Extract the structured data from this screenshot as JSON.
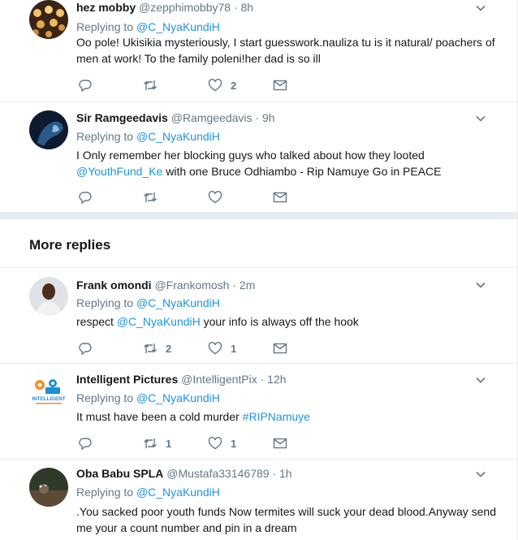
{
  "tweets_top": [
    {
      "name": "hez mobby",
      "handle": "@zepphimobby78",
      "time": "· 8h",
      "replying_label": "Replying to",
      "replying_handle": "@C_NyaKundiH",
      "text": "Oo pole! Ukisikia mysteriously, I start guesswork.nauliza tu is it natural/ poachers of men at work! To the family poleni!her dad is so ill",
      "retweets": "",
      "likes": "2"
    },
    {
      "name": "Sir Ramgeedavis",
      "handle": "@Ramgeedavis",
      "time": "· 9h",
      "replying_label": "Replying to",
      "replying_handle": "@C_NyaKundiH",
      "text_a": "I Only remember her blocking guys who talked about how they looted",
      "text_link": "@YouthFund_Ke",
      "text_b": " with one Bruce Odhiambo - Rip Namuye Go in PEACE",
      "retweets": "",
      "likes": ""
    }
  ],
  "section": {
    "more_replies": "More replies"
  },
  "tweets_more": [
    {
      "name": "Frank omondi",
      "handle": "@Frankomosh",
      "time": "· 2m",
      "replying_label": "Replying to",
      "replying_handle": "@C_NyaKundiH",
      "text_a": "respect ",
      "text_link": "@C_NyaKundiH",
      "text_b": " your info is always off the hook",
      "retweets": "2",
      "likes": "1"
    },
    {
      "name": "Intelligent Pictures",
      "handle": "@IntelligentPix",
      "time": "· 12h",
      "replying_label": "Replying to",
      "replying_handle": "@C_NyaKundiH",
      "text_a": "It must have been a cold murder ",
      "text_link": "#RIPNamuye",
      "retweets": "1",
      "likes": "1",
      "avatar_text": "INTELLIGENT"
    },
    {
      "name": "Oba Babu SPLA",
      "handle": "@Mustafa33146789",
      "time": "· 1h",
      "replying_label": "Replying to",
      "replying_handle": "@C_NyaKundiH",
      "text": ".You sacked poor youth funds Now termites will suck your dead blood.Anyway send me your a count number and pin in a dream"
    }
  ],
  "colors": {
    "link": "#1b95e0",
    "muted": "#657786",
    "text": "#14171a",
    "border": "#e6ecf0"
  },
  "icons": {
    "reply": "reply-icon",
    "retweet": "retweet-icon",
    "like": "heart-icon",
    "message": "envelope-icon",
    "caret": "chevron-down-icon"
  }
}
